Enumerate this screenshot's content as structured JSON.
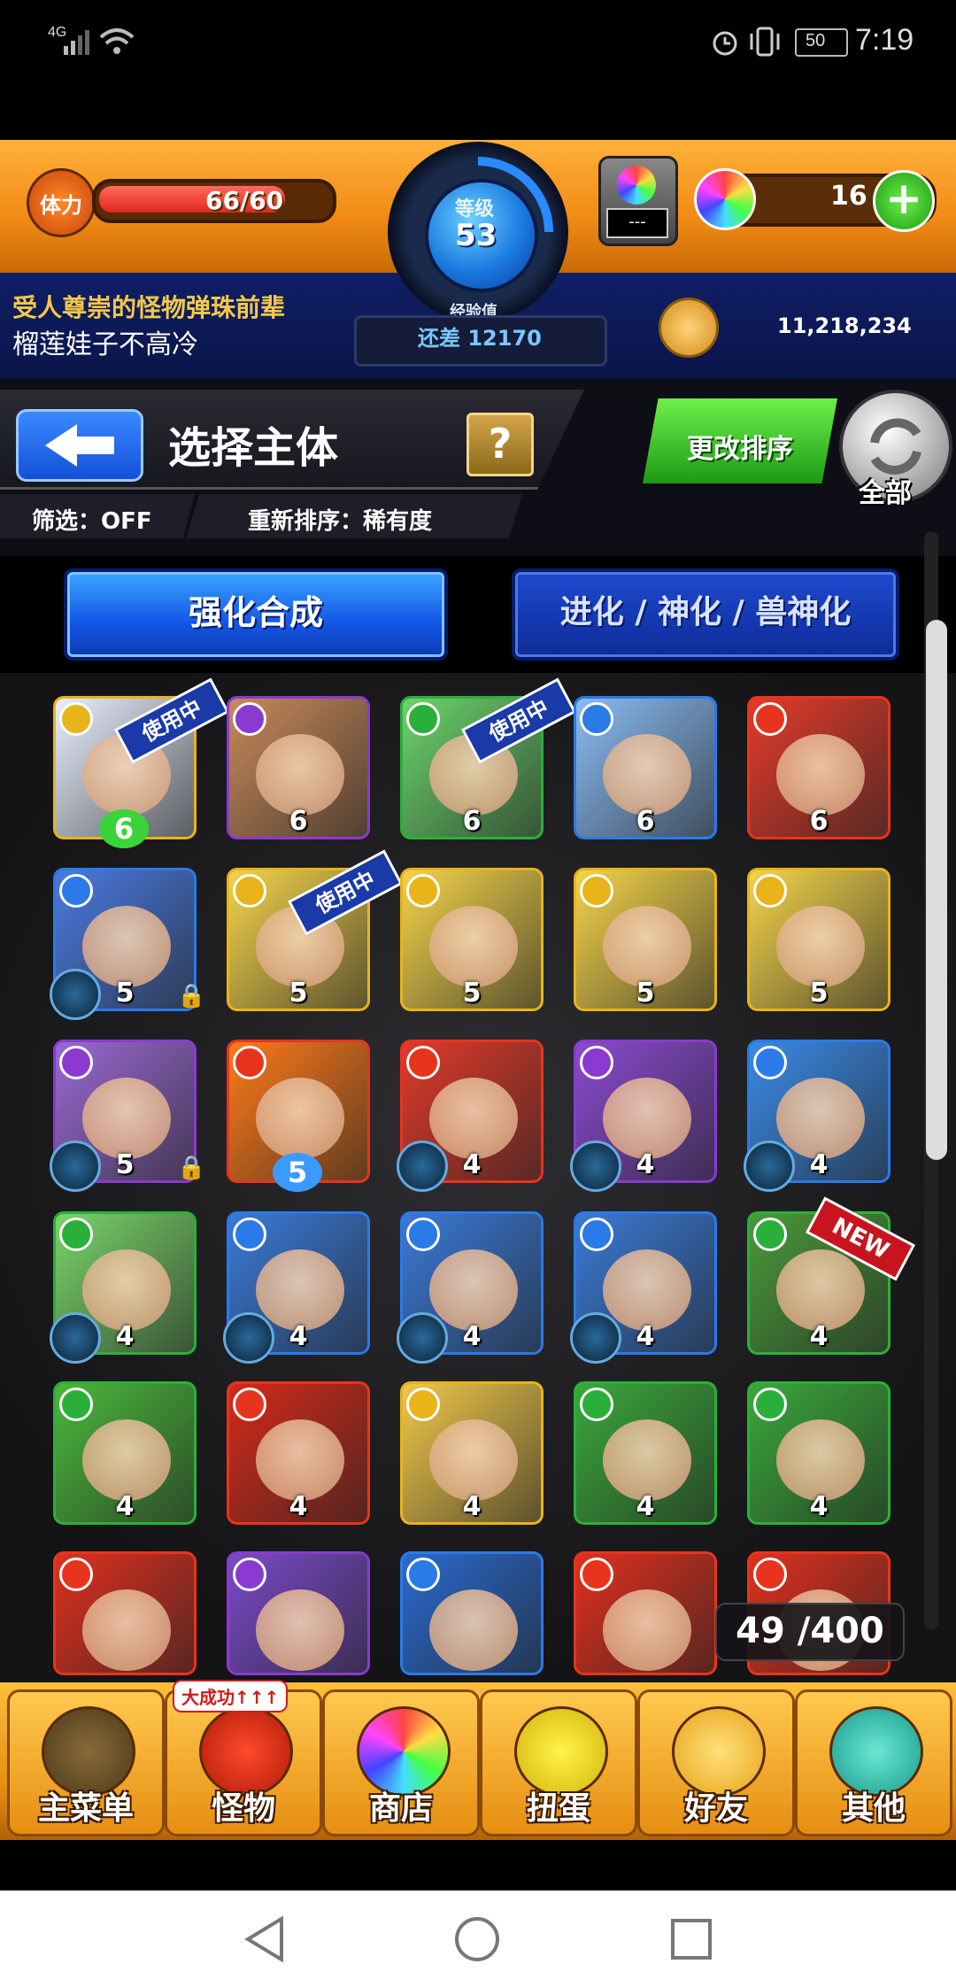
{
  "status_bar": {
    "network": "4G",
    "battery": "50",
    "time": "7:19"
  },
  "hud": {
    "stamina_label": "体力",
    "stamina_value": "66/60",
    "stamina_fill": 1.0,
    "level_label": "等级",
    "level_value": "53",
    "exp_label": "经验值",
    "exp_remaining": "还差 12170",
    "orb_slot_value": "---",
    "orb_count": "16",
    "player_title": "受人尊崇的怪物弹珠前辈",
    "player_name": "榴莲娃子不高冷",
    "gold": "11,218,234"
  },
  "header": {
    "title": "选择主体",
    "help": "?",
    "filter": "筛选：OFF",
    "sort": "重新排序：稀有度",
    "change_sort_button": "更改排序",
    "all_button": "全部"
  },
  "tabs": {
    "strengthen": "强化合成",
    "evolve": "进化 / 神化 / 兽神化"
  },
  "cards": [
    {
      "element": "light",
      "bg": "#e8f0ff",
      "level": "6",
      "badge": "使用中",
      "level_style": "clover"
    },
    {
      "element": "dark",
      "bg": "#c88a5a",
      "level": "6"
    },
    {
      "element": "wood",
      "bg": "#6cd46c",
      "level": "6",
      "badge": "使用中"
    },
    {
      "element": "water",
      "bg": "#8abcf4",
      "level": "6"
    },
    {
      "element": "fire",
      "bg": "#e43a2a",
      "level": "6"
    },
    {
      "element": "water",
      "bg": "#4a7ae0",
      "level": "5",
      "orb": true,
      "lock": true
    },
    {
      "element": "light",
      "bg": "#f4d44a",
      "level": "5",
      "badge": "使用中"
    },
    {
      "element": "light",
      "bg": "#f4d44a",
      "level": "5"
    },
    {
      "element": "light",
      "bg": "#f4d44a",
      "level": "5"
    },
    {
      "element": "light",
      "bg": "#f4d44a",
      "level": "5"
    },
    {
      "element": "dark",
      "bg": "#9a6ad4",
      "level": "5",
      "orb": true,
      "lock": true
    },
    {
      "element": "fire",
      "bg": "#ff7a1a",
      "level": "5",
      "level_style": "flower"
    },
    {
      "element": "fire",
      "bg": "#e03a2a",
      "level": "4",
      "orb": true
    },
    {
      "element": "dark",
      "bg": "#8a4ad0",
      "level": "4",
      "orb": true
    },
    {
      "element": "water",
      "bg": "#3a8ae8",
      "level": "4",
      "orb": true
    },
    {
      "element": "wood",
      "bg": "#7ad46a",
      "level": "4",
      "orb": true
    },
    {
      "element": "water",
      "bg": "#3a7ad8",
      "level": "4",
      "orb": true
    },
    {
      "element": "water",
      "bg": "#3a7ad8",
      "level": "4",
      "orb": true
    },
    {
      "element": "water",
      "bg": "#3a7ad8",
      "level": "4",
      "orb": true
    },
    {
      "element": "wood",
      "bg": "#4a9a3a",
      "level": "4",
      "badge_new": "NEW"
    },
    {
      "element": "wood",
      "bg": "#4ab83a",
      "level": "4"
    },
    {
      "element": "fire",
      "bg": "#d42a1a",
      "level": "4"
    },
    {
      "element": "light",
      "bg": "#f0c84a",
      "level": "4"
    },
    {
      "element": "wood",
      "bg": "#3aa83a",
      "level": "4"
    },
    {
      "element": "wood",
      "bg": "#3aa83a",
      "level": "4"
    },
    {
      "element": "fire",
      "bg": "#e0301e",
      "level": ""
    },
    {
      "element": "dark",
      "bg": "#7a4ac8",
      "level": ""
    },
    {
      "element": "water",
      "bg": "#2a6ad0",
      "level": ""
    },
    {
      "element": "fire",
      "bg": "#e0301e",
      "level": ""
    },
    {
      "element": "fire",
      "bg": "#e0301e",
      "level": ""
    }
  ],
  "box_count": "49 /400",
  "nav": [
    {
      "label": "主菜单",
      "icon": "castle-gate-icon"
    },
    {
      "label": "怪物",
      "icon": "red-monster-icon",
      "badge": "大成功↑↑↑"
    },
    {
      "label": "商店",
      "icon": "rainbow-orb-icon"
    },
    {
      "label": "扭蛋",
      "icon": "egg-icon"
    },
    {
      "label": "好友",
      "icon": "friends-icon"
    },
    {
      "label": "其他",
      "icon": "question-icon"
    }
  ],
  "colors": {
    "fire": "#e8341c",
    "water": "#2a7ae8",
    "wood": "#2ab03a",
    "light": "#e8b41a",
    "dark": "#8a3ad0"
  }
}
